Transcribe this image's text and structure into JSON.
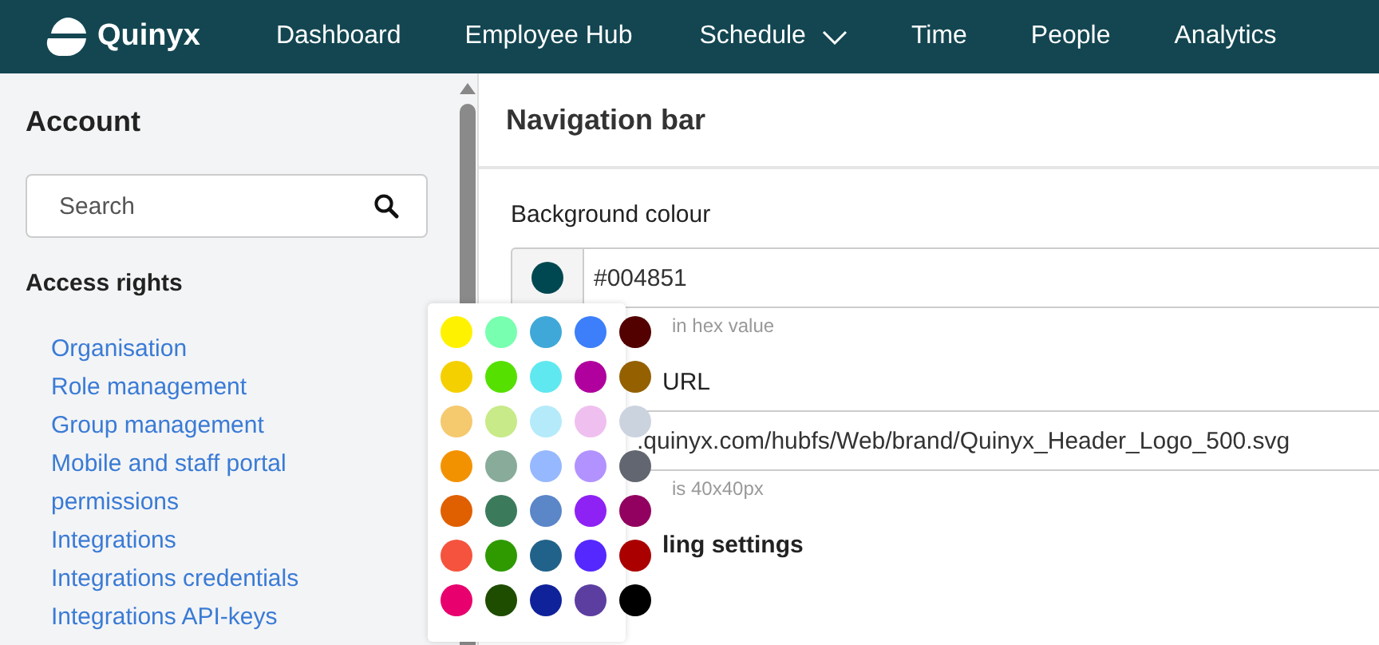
{
  "header": {
    "logo_text": "Quinyx",
    "nav": [
      {
        "label": "Dashboard",
        "dropdown": false
      },
      {
        "label": "Employee Hub",
        "dropdown": false
      },
      {
        "label": "Schedule",
        "dropdown": true
      },
      {
        "label": "Time",
        "dropdown": false
      },
      {
        "label": "People",
        "dropdown": false
      },
      {
        "label": "Analytics",
        "dropdown": false
      }
    ]
  },
  "sidebar": {
    "title": "Account",
    "search": {
      "placeholder": "Search"
    },
    "section": "Access rights",
    "items": [
      "Organisation",
      "Role management",
      "Group management",
      "Mobile and staff portal permissions",
      "Integrations",
      "Integrations credentials",
      "Integrations API-keys"
    ]
  },
  "main": {
    "title": "Navigation bar",
    "background_label": "Background colour",
    "background_value": "#004851",
    "background_hint": "in hex value",
    "logo_label": "URL",
    "logo_value": ".quinyx.com/hubfs/Web/brand/Quinyx_Header_Logo_500.svg",
    "logo_hint": "is 40x40px",
    "section": "ling settings"
  },
  "palette": {
    "colors": [
      {
        "color": "#fff200"
      },
      {
        "color": "#78ffb0"
      },
      {
        "color": "#40a8d8"
      },
      {
        "color": "#3d7ffa"
      },
      {
        "color": "#520000"
      },
      {
        "color": "#f5d000"
      },
      {
        "color": "#55e000"
      },
      {
        "color": "#60e8f0"
      },
      {
        "color": "#b0009e"
      },
      {
        "color": "#946000"
      },
      {
        "color": "#f5c96e"
      },
      {
        "color": "#c8ea88"
      },
      {
        "color": "#b5eafa"
      },
      {
        "color": "#efc0ef"
      },
      {
        "color": "#cbd3df"
      },
      {
        "color": "#f39200"
      },
      {
        "color": "#88ab9a"
      },
      {
        "color": "#96b8ff"
      },
      {
        "color": "#b292ff"
      },
      {
        "color": "#626670"
      },
      {
        "color": "#e06000"
      },
      {
        "color": "#3c7a5c"
      },
      {
        "color": "#5b86c8"
      },
      {
        "color": "#8e22f5"
      },
      {
        "color": "#920060"
      },
      {
        "color": "#f5533d"
      },
      {
        "color": "#2e9a00"
      },
      {
        "color": "#21628a"
      },
      {
        "color": "#5428ff"
      },
      {
        "color": "#aa0000"
      },
      {
        "color": "#e8006e"
      },
      {
        "color": "#1e4d00"
      },
      {
        "color": "#10229a"
      },
      {
        "color": "#5c3ea0"
      },
      {
        "color": "#000000"
      }
    ]
  }
}
